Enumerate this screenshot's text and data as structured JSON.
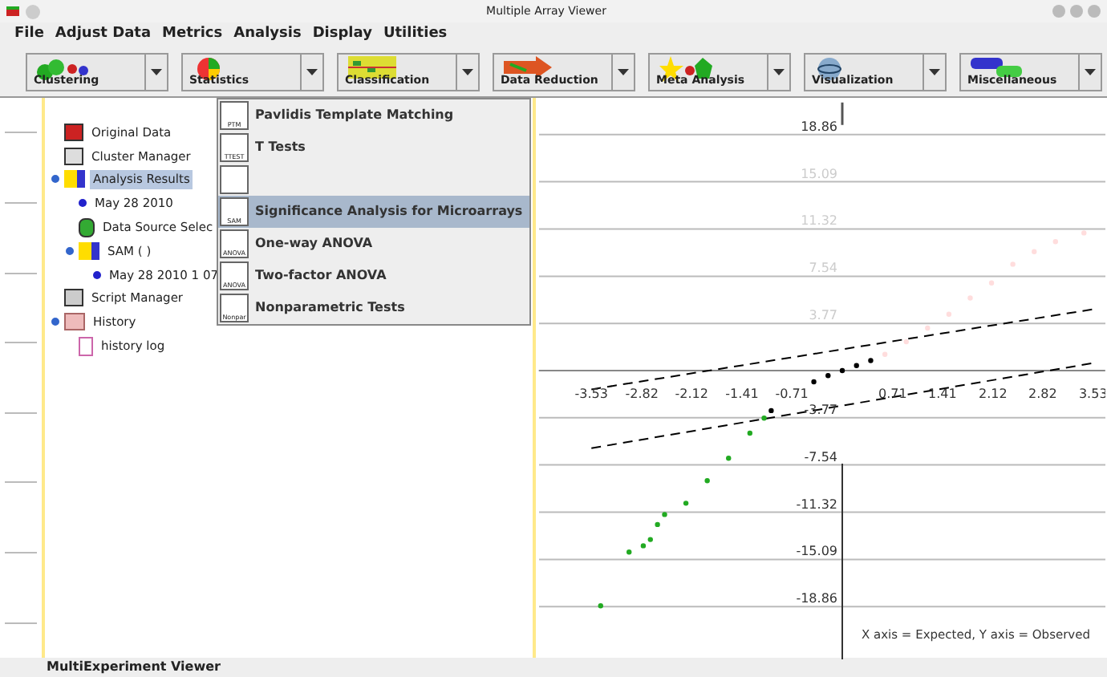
{
  "window": {
    "title": "Multiple Array Viewer"
  },
  "menu": [
    "File",
    "Adjust Data",
    "Metrics",
    "Analysis",
    "Display",
    "Utilities"
  ],
  "toolbar": [
    {
      "label": "Clustering",
      "kind": "clustering"
    },
    {
      "label": "Statistics",
      "kind": "statistics"
    },
    {
      "label": "Classification",
      "kind": "classification"
    },
    {
      "label": "Data Reduction",
      "kind": "reduction"
    },
    {
      "label": "Meta Analysis",
      "kind": "meta"
    },
    {
      "label": "Visualization",
      "kind": "visualization"
    },
    {
      "label": "Miscellaneous",
      "kind": "misc"
    }
  ],
  "tree": [
    {
      "label": "Original Data",
      "kind": "data"
    },
    {
      "label": "Cluster Manager",
      "kind": "manager"
    },
    {
      "label": "Analysis Results",
      "kind": "results",
      "selected": true,
      "expanded": true,
      "children": [
        {
          "label": "May 28 2010",
          "kind": "dot"
        },
        {
          "label": "Data Source Selec",
          "kind": "source"
        },
        {
          "label": "SAM ( )",
          "kind": "results",
          "expanded": true,
          "children": [
            {
              "label": "May 28 2010 1 07",
              "kind": "dot"
            }
          ]
        }
      ]
    },
    {
      "label": "Script Manager",
      "kind": "script"
    },
    {
      "label": "History",
      "kind": "history",
      "expanded": true,
      "children": [
        {
          "label": "history log",
          "kind": "file"
        }
      ]
    }
  ],
  "dropdown": [
    {
      "label": "Pavlidis Template Matching",
      "icon": "PTM",
      "selected": false
    },
    {
      "label": "T Tests",
      "icon": "TTEST",
      "selected": false
    },
    {
      "selected": false
    },
    {
      "label": "Significance Analysis for Microarrays",
      "icon": "SAM",
      "selected": true
    },
    {
      "label": "One-way ANOVA",
      "icon": "ANOVA",
      "selected": false
    },
    {
      "label": "Two-factor ANOVA",
      "icon": "ANOVA",
      "selected": false
    },
    {
      "label": "Nonparametric Tests",
      "icon": "Nonpar",
      "selected": false
    }
  ],
  "plot": {
    "chart_data": {
      "type": "scatter",
      "grid": true,
      "xlim": [
        -4.27,
        3.7
      ],
      "ylim": [
        -18.86,
        18.86
      ],
      "xticks": [
        -3.53,
        -2.82,
        -2.12,
        -1.41,
        -0.71,
        0.71,
        1.41,
        2.12,
        2.82,
        3.53
      ],
      "yticks": [
        18.86,
        15.09,
        11.32,
        7.54,
        3.77,
        -3.77,
        -7.54,
        -11.32,
        -15.09,
        -18.86
      ],
      "series": [
        {
          "color": "#22aa22",
          "x": [
            -3.4,
            -3.0,
            -2.8,
            -2.7,
            -2.6,
            -2.5,
            -2.2,
            -1.9,
            -1.6,
            -1.3,
            -1.1
          ],
          "values": [
            -18.8,
            -14.5,
            -14,
            -13.5,
            -12.3,
            -11.5,
            -10.6,
            -8.8,
            -7,
            -5,
            -3.8
          ]
        },
        {
          "color": "#000000",
          "x": [
            -1.0,
            -0.4,
            -0.2,
            0,
            0.2,
            0.4
          ],
          "values": [
            -3.2,
            -0.9,
            -0.4,
            0,
            0.4,
            0.8
          ]
        },
        {
          "color": "#ffdddd",
          "x": [
            0.6,
            0.9,
            1.2,
            1.5,
            1.8,
            2.1,
            2.4,
            2.7,
            3.0,
            3.4
          ],
          "values": [
            1.3,
            2.3,
            3.4,
            4.5,
            5.8,
            7,
            8.5,
            9.5,
            10.3,
            11
          ]
        },
        {
          "type": "line",
          "line_style": "dashed",
          "color": "#000000",
          "x": [
            -3.53,
            3.53
          ],
          "values": [
            -1.5,
            4.9
          ]
        },
        {
          "type": "line",
          "line_style": "dashed",
          "color": "#000000",
          "x": [
            -3.53,
            3.53
          ],
          "values": [
            -6.2,
            0.6
          ]
        }
      ],
      "annotations": [
        "X axis = Expected, Y axis = Observed"
      ]
    }
  },
  "status_bar": "MultiExperiment Viewer"
}
